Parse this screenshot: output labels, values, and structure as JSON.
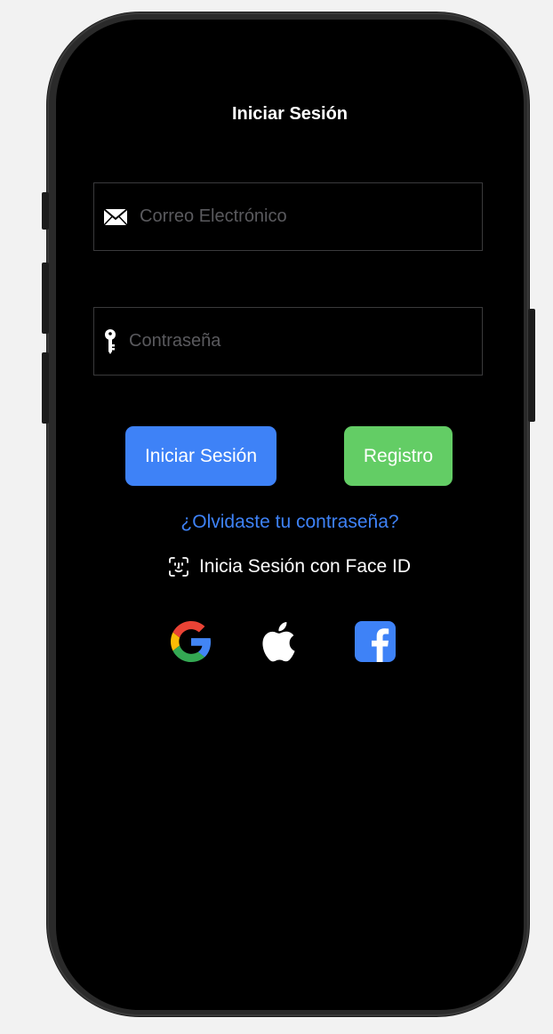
{
  "screen": {
    "title": "Iniciar Sesión"
  },
  "form": {
    "email": {
      "placeholder": "Correo Electrónico",
      "value": "",
      "icon": "envelope-icon"
    },
    "password": {
      "placeholder": "Contraseña",
      "value": "",
      "icon": "key-icon"
    }
  },
  "actions": {
    "login_label": "Iniciar Sesión",
    "register_label": "Registro",
    "forgot_label": "¿Olvidaste tu contraseña?",
    "faceid_label": "Inicia Sesión con Face ID"
  },
  "social": [
    {
      "name": "google",
      "icon": "google-logo-icon"
    },
    {
      "name": "apple",
      "icon": "apple-logo-icon"
    },
    {
      "name": "facebook",
      "icon": "facebook-logo-icon"
    }
  ],
  "colors": {
    "background": "#000000",
    "primary": "#3e82f7",
    "success": "#63cd65",
    "field_border": "#3a3a3c",
    "placeholder": "#5a5a5e",
    "text": "#ffffff"
  }
}
